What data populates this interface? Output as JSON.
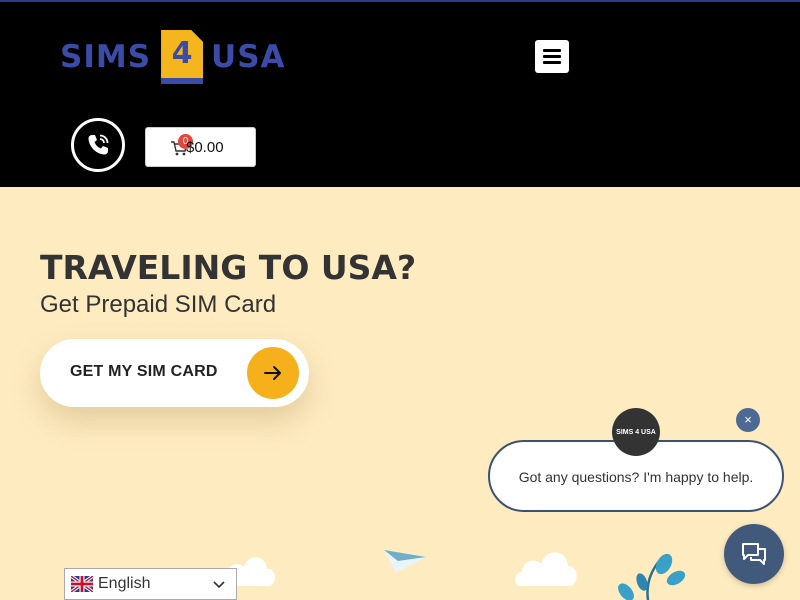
{
  "header": {
    "logo": {
      "word_left": "SIMS",
      "number": "4",
      "word_right": "USA"
    },
    "cart": {
      "count": "0",
      "total": "$0.00"
    }
  },
  "hero": {
    "title": "TRAVELING TO USA?",
    "subtitle": "Get Prepaid SIM Card",
    "cta_label": "GET MY SIM CARD"
  },
  "chat": {
    "avatar_text": "SIMS 4 USA",
    "message": "Got any questions? I'm happy to help.",
    "close_label": "×"
  },
  "language": {
    "selected": "English"
  },
  "icons": {
    "menu": "hamburger-menu-icon",
    "phone": "phone-ringing-icon",
    "cart": "shopping-cart-icon",
    "cta_arrow": "arrow-right-icon",
    "chat_launcher": "chat-bubbles-icon",
    "flag": "uk-flag-icon",
    "dropdown": "chevron-down-icon"
  },
  "colors": {
    "brand_blue": "#3b4ba8",
    "brand_yellow": "#f5b51c",
    "hero_background": "#feebc0",
    "header_background": "#000000",
    "chat_accent": "#415a7b"
  }
}
